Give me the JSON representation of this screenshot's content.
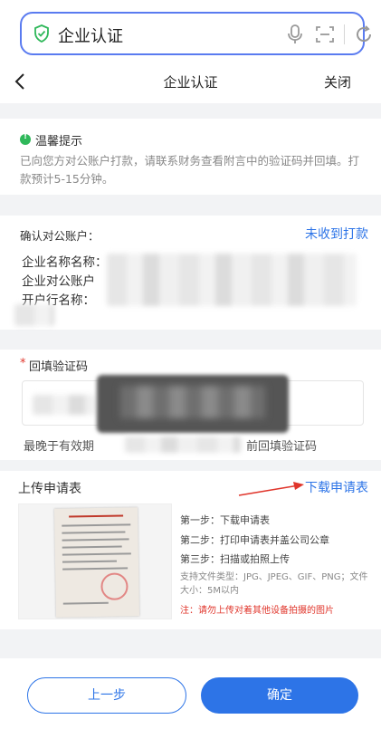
{
  "search": {
    "text": "企业认证"
  },
  "nav": {
    "back_icon": "chevron-left-icon",
    "title": "企业认证",
    "close": "关闭"
  },
  "tip": {
    "title": "温馨提示",
    "body": "已向您方对公账户打款，请联系财务查看附言中的验证码并回填。打款预计5-15分钟。"
  },
  "account": {
    "title": "确认对公账户：",
    "not_received": "未收到打款",
    "rows": [
      "企业名称名称：",
      "企业对公账户",
      "开户行名称："
    ]
  },
  "verify": {
    "required_mark": "*",
    "label": "回填验证码",
    "deadline_prefix": "最晚于有效期",
    "deadline_suffix": "前回填验证码"
  },
  "upload": {
    "title": "上传申请表",
    "download": "下载申请表",
    "steps": [
      "第一步：下载申请表",
      "第二步：打印申请表并盖公司公章",
      "第三步：扫描或拍照上传"
    ],
    "support": "支持文件类型：JPG、JPEG、GIF、PNG；文件大小：5M以内",
    "note": "注：请勿上传对着其他设备拍摄的图片"
  },
  "buttons": {
    "prev": "上一步",
    "confirm": "确定"
  },
  "colors": {
    "accent": "#2d74e7",
    "search_border": "#5a7bf0",
    "tip_icon": "#2fb85a",
    "required": "#e0352b",
    "annotation_arrow": "#e0352b"
  }
}
